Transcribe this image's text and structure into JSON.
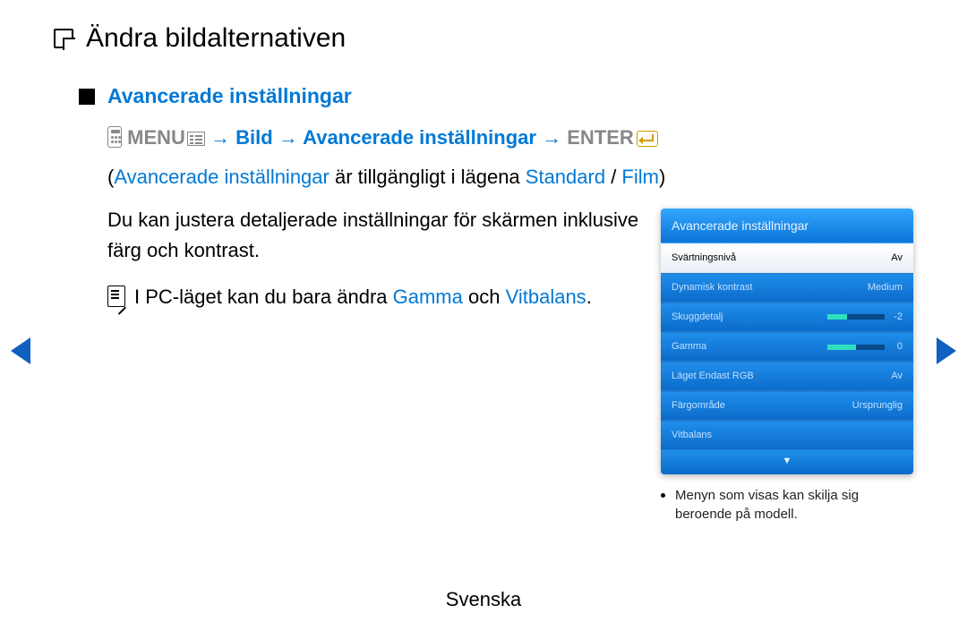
{
  "page_title": "Ändra bildalternativen",
  "section_title": "Avancerade inställningar",
  "path": {
    "menu_label": "MENU",
    "step1": "Bild",
    "step2": "Avancerade inställningar",
    "enter_label": "ENTER"
  },
  "availability": {
    "prefix_open": "(",
    "feature": "Avancerade inställningar",
    "middle": " är tillgängligt i lägena ",
    "mode1": "Standard",
    "sep": " / ",
    "mode2": "Film",
    "suffix_close": ")"
  },
  "body_text": "Du kan justera detaljerade inställningar för skärmen inklusive färg och kontrast.",
  "pc_note": {
    "pre": "I PC-läget kan du bara ändra ",
    "t1": "Gamma",
    "mid": " och ",
    "t2": "Vitbalans",
    "post": "."
  },
  "osd": {
    "title": "Avancerade inställningar",
    "rows": [
      {
        "label": "Svärtningsnivå",
        "value": "Av",
        "type": "text",
        "selected": true
      },
      {
        "label": "Dynamisk kontrast",
        "value": "Medium",
        "type": "text"
      },
      {
        "label": "Skuggdetalj",
        "value": "-2",
        "type": "slider",
        "fill_pct": 35,
        "fill_color": "#2fe0c0"
      },
      {
        "label": "Gamma",
        "value": "0",
        "type": "slider",
        "fill_pct": 50,
        "fill_color": "#2fe0c0"
      },
      {
        "label": "Läget Endast RGB",
        "value": "Av",
        "type": "text"
      },
      {
        "label": "Färgområde",
        "value": "Ursprunglig",
        "type": "text"
      },
      {
        "label": "Vitbalans",
        "value": "",
        "type": "text"
      }
    ]
  },
  "panel_note": "Menyn som visas kan skilja sig beroende på modell.",
  "footer": "Svenska"
}
